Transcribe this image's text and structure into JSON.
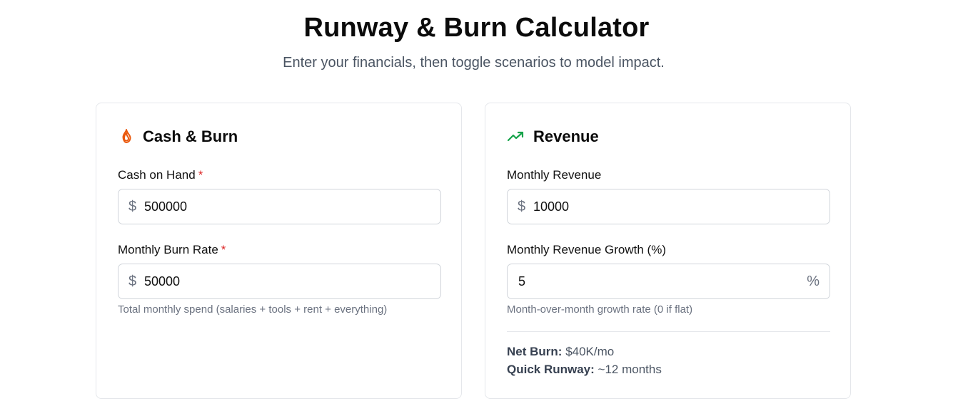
{
  "header": {
    "title": "Runway & Burn Calculator",
    "subtitle": "Enter your financials, then toggle scenarios to model impact."
  },
  "cash_burn": {
    "icon": "flame-icon",
    "title": "Cash & Burn",
    "cash_on_hand": {
      "label": "Cash on Hand",
      "required_mark": "*",
      "prefix": "$",
      "value": "500000"
    },
    "monthly_burn": {
      "label": "Monthly Burn Rate",
      "required_mark": "*",
      "prefix": "$",
      "value": "50000",
      "help": "Total monthly spend (salaries + tools + rent + everything)"
    }
  },
  "revenue": {
    "icon": "trending-up-icon",
    "title": "Revenue",
    "monthly_revenue": {
      "label": "Monthly Revenue",
      "prefix": "$",
      "value": "10000"
    },
    "growth": {
      "label": "Monthly Revenue Growth (%)",
      "suffix": "%",
      "value": "5",
      "help": "Month-over-month growth rate (0 if flat)"
    },
    "summary": {
      "net_burn_label": "Net Burn:",
      "net_burn_value": "$40K/mo",
      "quick_runway_label": "Quick Runway:",
      "quick_runway_value": "~12 months"
    }
  },
  "colors": {
    "flame": "#ea580c",
    "trend": "#16a34a",
    "required": "#dc2626",
    "border": "#e5e7eb"
  }
}
